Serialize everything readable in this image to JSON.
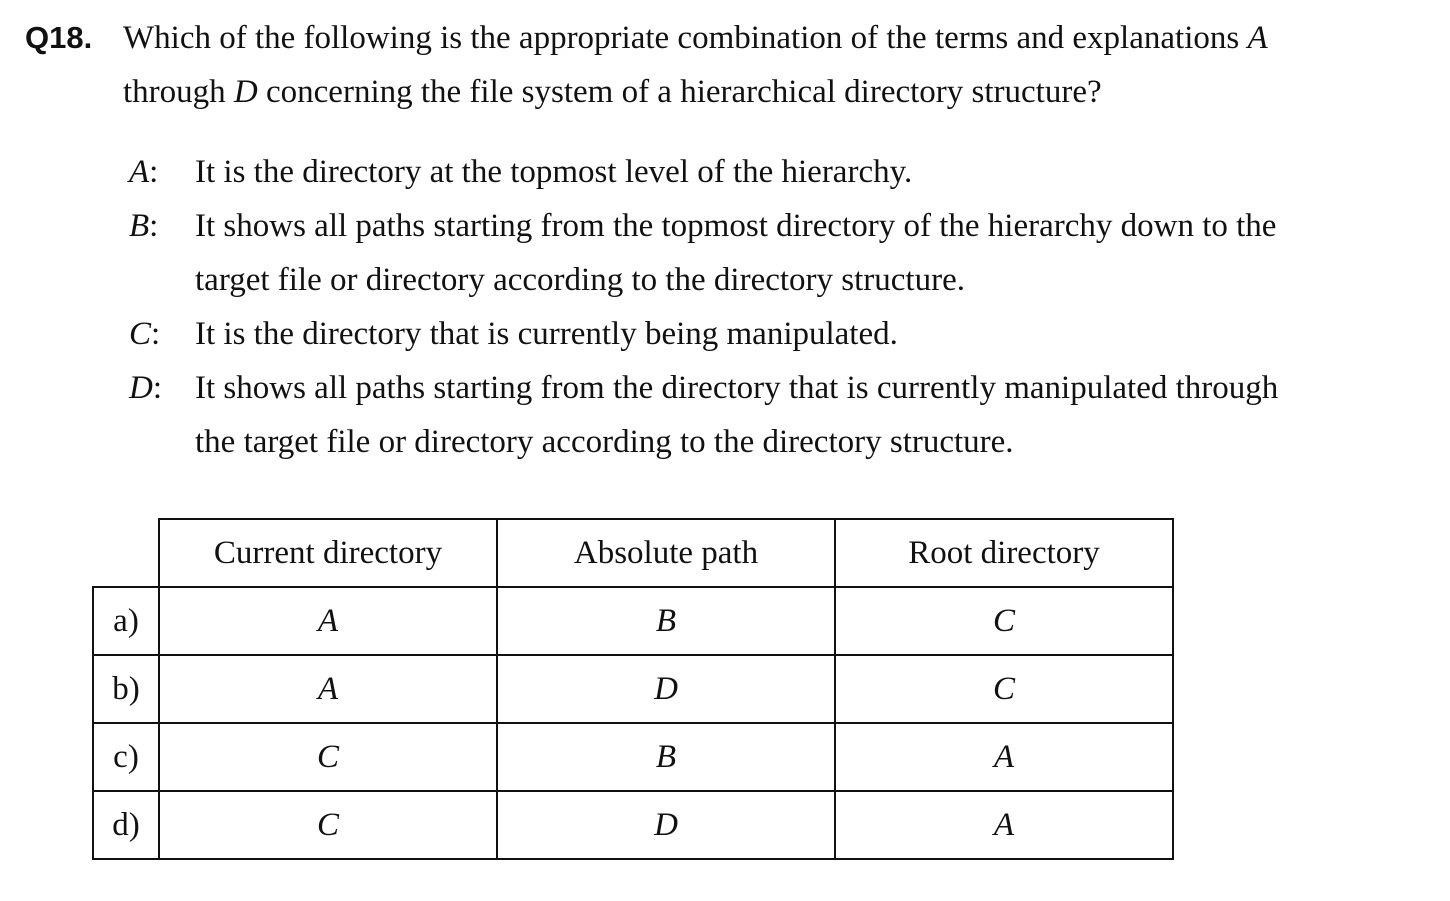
{
  "question": {
    "number": "Q18.",
    "line1_pre": "Which of the following is the appropriate combination of the terms and explanations ",
    "line1_var": "A",
    "line2_pre": "through ",
    "line2_var": "D",
    "line2_post": " concerning the file system of a hierarchical directory structure?"
  },
  "options": [
    {
      "letter": "A",
      "lines": [
        "It is the directory at the topmost level of the hierarchy."
      ]
    },
    {
      "letter": "B",
      "lines": [
        "It shows all paths starting from the topmost directory of the hierarchy down to the",
        "target file or directory according to the directory structure."
      ]
    },
    {
      "letter": "C",
      "lines": [
        "It is the directory that is currently being manipulated."
      ]
    },
    {
      "letter": "D",
      "lines": [
        "It shows all paths starting from the directory that is currently manipulated through",
        "the target file or directory according to the directory structure."
      ]
    }
  ],
  "table": {
    "headers": [
      "Current directory",
      "Absolute path",
      "Root directory"
    ],
    "rows": [
      {
        "label": "a)",
        "cells": [
          "A",
          "B",
          "C"
        ]
      },
      {
        "label": "b)",
        "cells": [
          "A",
          "D",
          "C"
        ]
      },
      {
        "label": "c)",
        "cells": [
          "C",
          "B",
          "A"
        ]
      },
      {
        "label": "d)",
        "cells": [
          "C",
          "D",
          "A"
        ]
      }
    ]
  }
}
